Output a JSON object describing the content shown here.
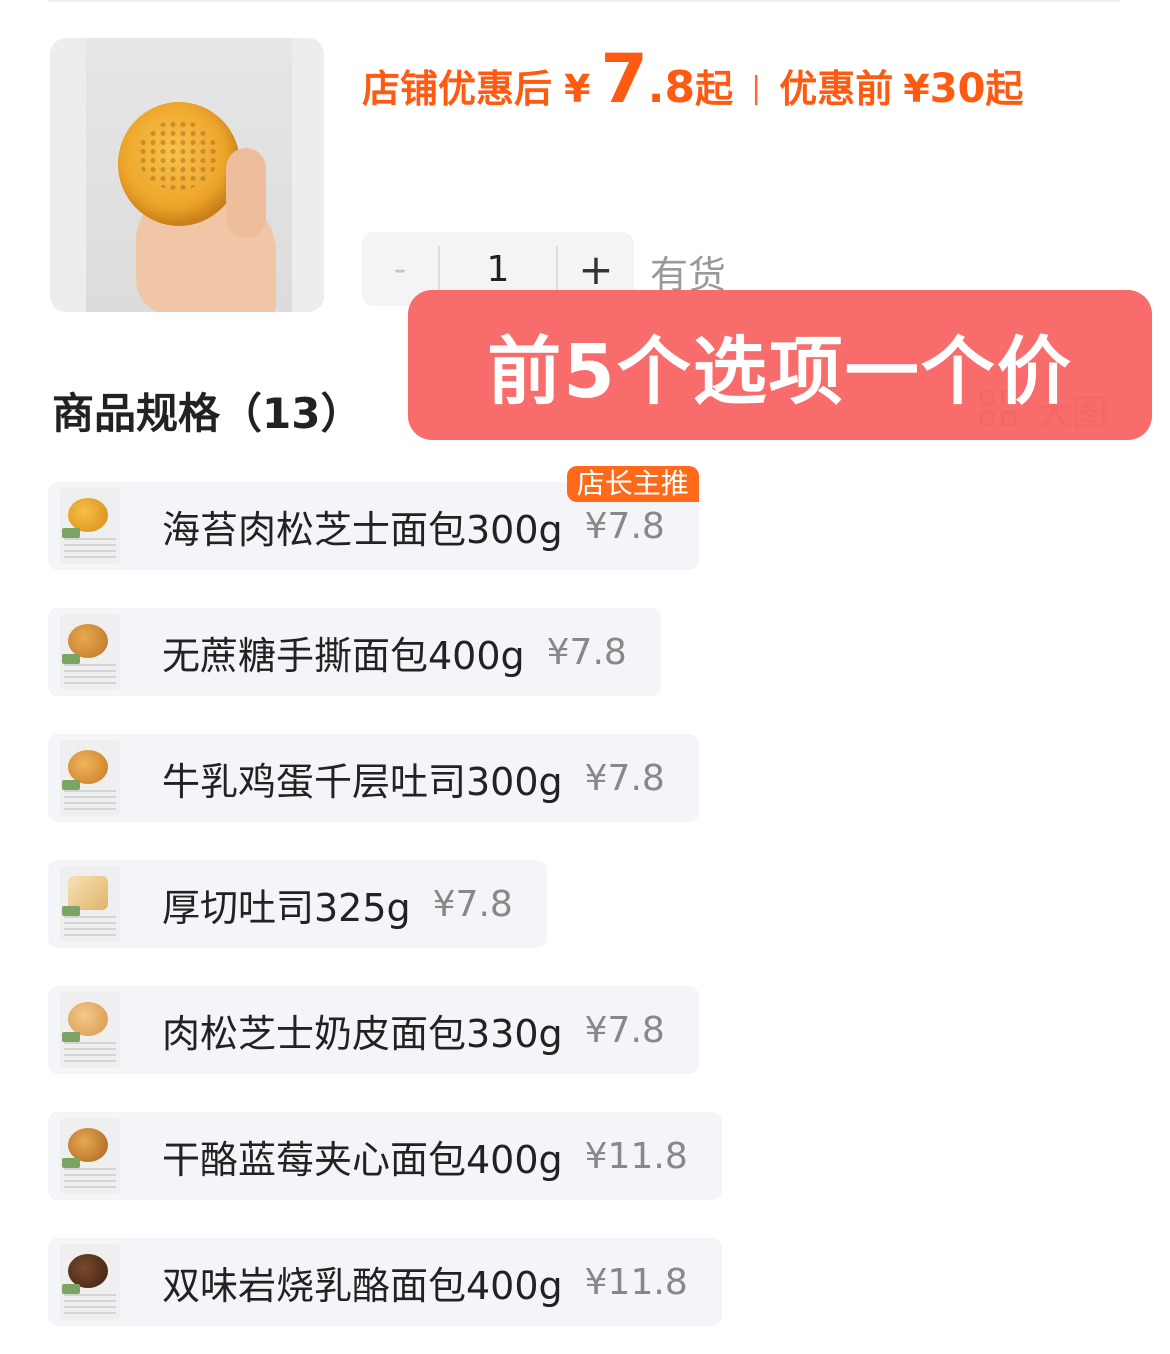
{
  "product": {
    "price_label": "店铺优惠后",
    "price_currency": "¥",
    "price_int": "7",
    "price_dec": ".8",
    "price_suffix": "起",
    "separator": "|",
    "orig_label": "优惠前",
    "orig_currency": "¥",
    "orig_price": "30",
    "orig_suffix": "起"
  },
  "stepper": {
    "minus": "-",
    "quantity": "1",
    "plus": "+"
  },
  "stock_status": "有货",
  "spec": {
    "title": "商品规格（13）",
    "big_image_label": "大图"
  },
  "banner_text": "前5个选项一个价",
  "items": [
    {
      "name": "海苔肉松芝士面包300g",
      "price": "¥7.8",
      "tag": "店长主推"
    },
    {
      "name": "无蔗糖手撕面包400g",
      "price": "¥7.8"
    },
    {
      "name": "牛乳鸡蛋千层吐司300g",
      "price": "¥7.8"
    },
    {
      "name": "厚切吐司325g",
      "price": "¥7.8"
    },
    {
      "name": "肉松芝士奶皮面包330g",
      "price": "¥7.8"
    },
    {
      "name": "干酪蓝莓夹心面包400g",
      "price": "¥11.8"
    },
    {
      "name": "双味岩烧乳酪面包400g",
      "price": "¥11.8"
    }
  ],
  "colors": {
    "accent": "#ff5a12",
    "banner": "#f7605e",
    "item_bg": "#f4f5f8"
  }
}
